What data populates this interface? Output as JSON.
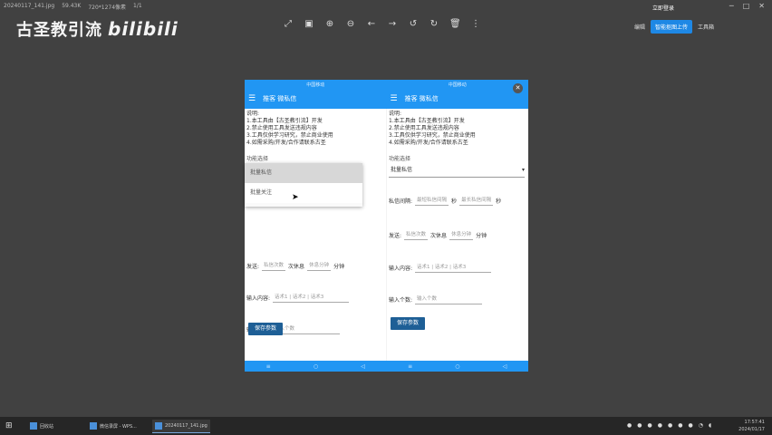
{
  "titlebar": {
    "filename": "20240117_141.jpg",
    "filesize": "59.43K",
    "dimensions": "720*1274像素",
    "index": "1/1",
    "login": "立即登录"
  },
  "watermark": {
    "text": "古圣教引流",
    "brand": "bilibili"
  },
  "rightbar": {
    "edit": "编辑",
    "smart": "智能抠图上传",
    "toolbox": "工具箱"
  },
  "phone": {
    "status_left": "中国移动",
    "status_right": "中国移动",
    "title": "推客 微私信",
    "notes_label": "说明:",
    "notes": [
      "1.本工具由【古圣教引流】开发",
      "2.禁止使用工具发送违规内容",
      "3.工具仅供学习研究，禁止商业使用",
      "4.如需采购/开发/合作请联系古圣"
    ],
    "func_label": "功能选择",
    "func_value": "批量私信",
    "dropdown": [
      "批量私信",
      "批量关注"
    ],
    "sendgap_label": "私信间隔:",
    "sendgap_min_ph": "最短私信间隔",
    "sendgap_max_ph": "最长私信间隔",
    "seconds": "秒",
    "send_label": "发送:",
    "send_count_ph": "私信次数",
    "send_rest_label": "次休息",
    "rest_minutes_ph": "休息分钟",
    "minutes": "分钟",
    "content_label": "输入内容:",
    "content_ph": "话术1 | 话术2 | 话术3",
    "count_label": "输入个数:",
    "count_ph": "输入个数",
    "save": "保存参数"
  },
  "taskbar": {
    "items": [
      "回收站",
      "微信录屏 - WPS...",
      "20240117_141.jpg"
    ],
    "time": "17:57:41",
    "date": "2024/01/17"
  }
}
